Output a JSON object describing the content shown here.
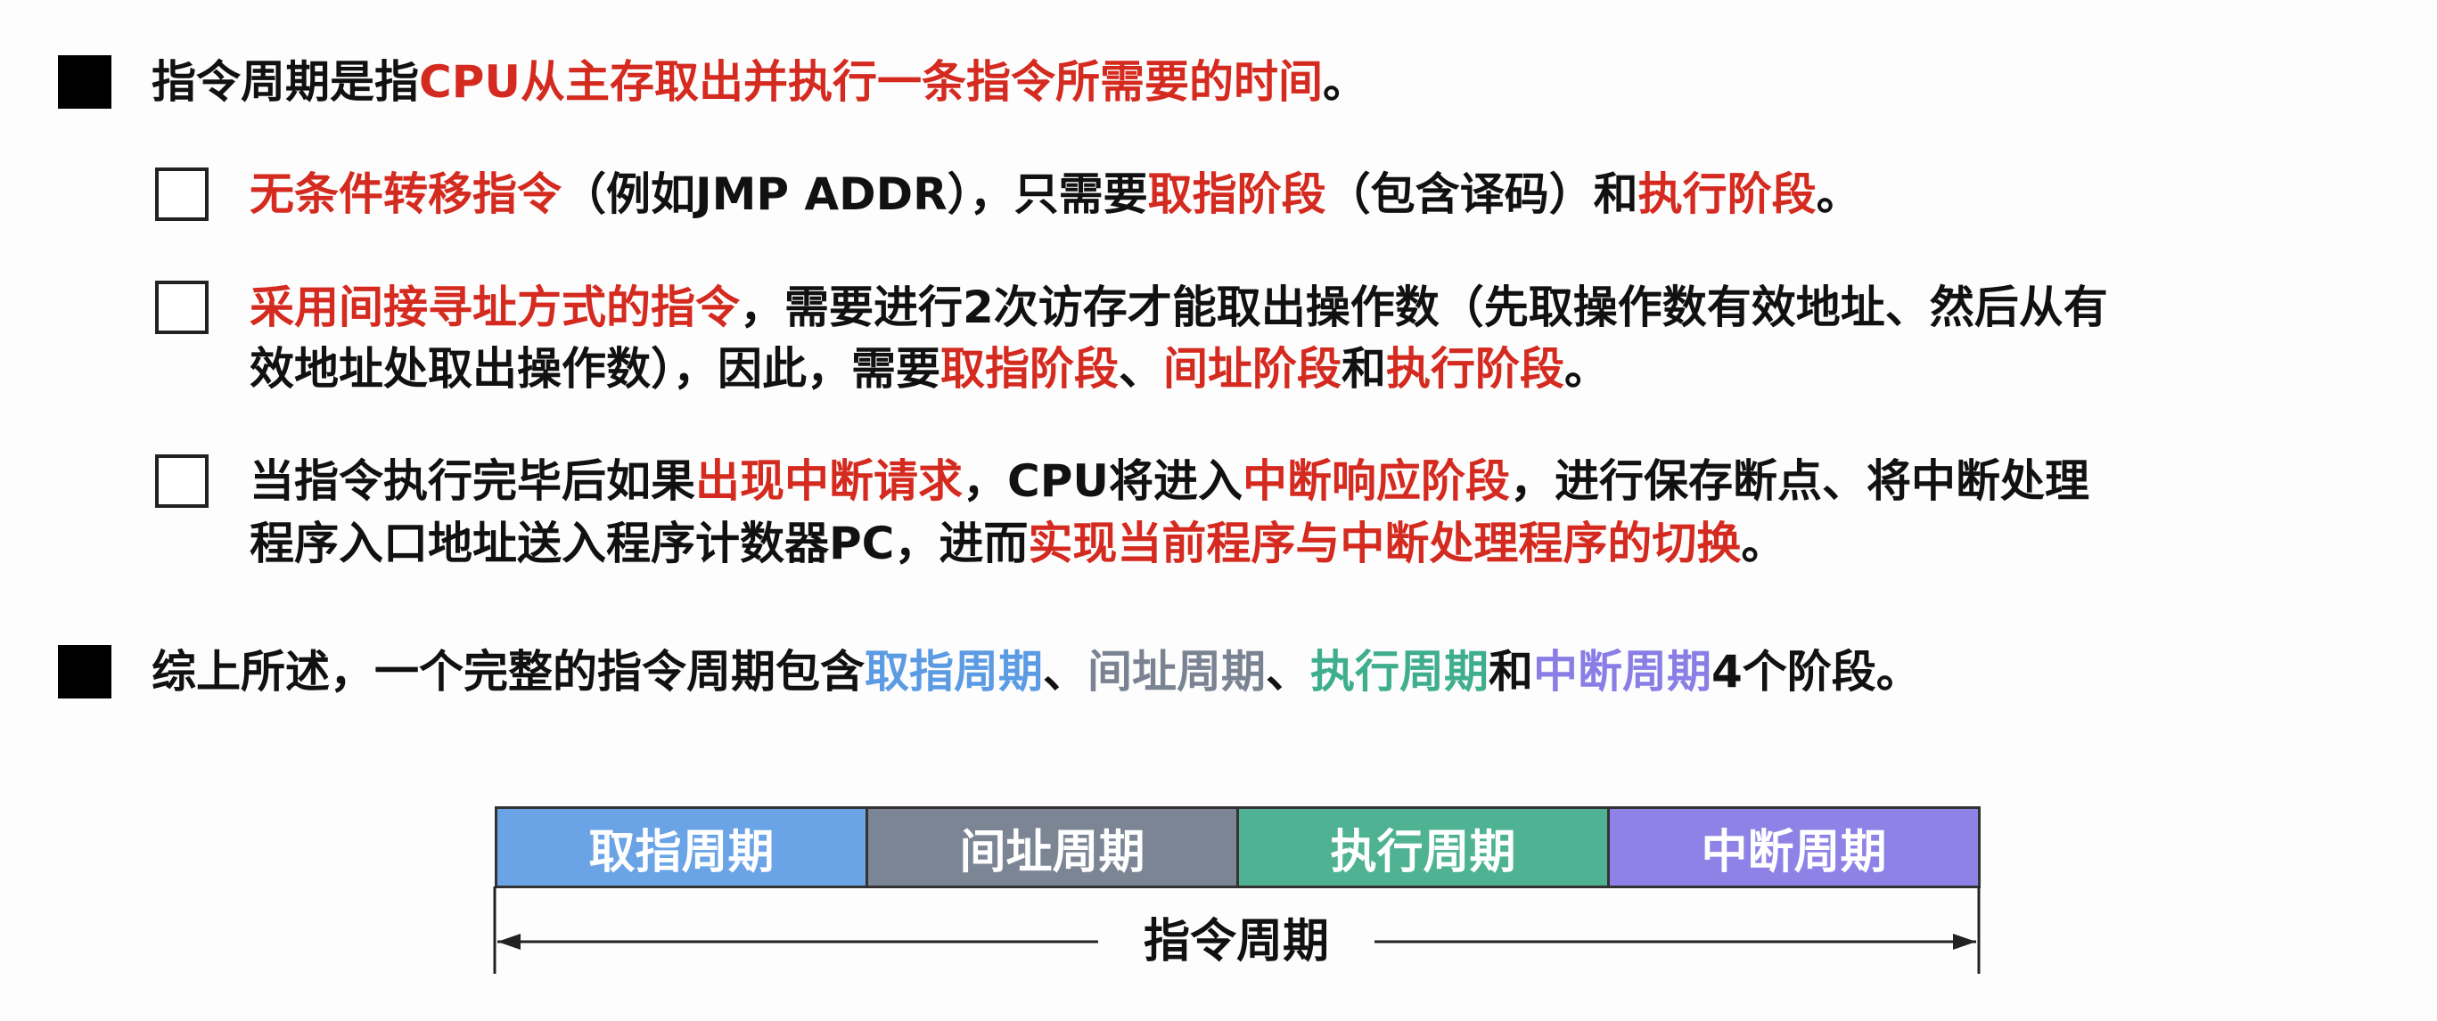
{
  "bullet1": {
    "prefix": "指令周期是指",
    "highlight": "CPU从主存取出并执行一条指令所需要的时间",
    "suffix": "。"
  },
  "sub1": {
    "h1": "无条件转移指令",
    "t1": "（例如JMP ADDR），只需要",
    "h2": "取指阶段",
    "t2": "（包含译码）和",
    "h3": "执行阶段",
    "t3": "。"
  },
  "sub2": {
    "h1": "采用间接寻址方式的指令",
    "t1": "，需要进行2次访存才能取出操作数（先取操作数有效地址、然后从有",
    "t2": "效地址处取出操作数），因此，需要",
    "h2": "取指阶段",
    "t3": "、",
    "h3": "间址阶段",
    "t4": "和",
    "h4": "执行阶段",
    "t5": "。"
  },
  "sub3": {
    "t1": "当指令执行完毕后如果",
    "h1": "出现中断请求",
    "t2": "，CPU将进入",
    "h2": "中断响应阶段",
    "t3": "，进行保存断点、将中断处理",
    "t4": "程序入口地址送入程序计数器PC，进而",
    "h3": "实现当前程序与中断处理程序的切换",
    "t5": "。"
  },
  "bullet2": {
    "prefix": "综上所述，一个完整的指令周期包含",
    "p1": "取指周期",
    "sep1": "、",
    "p2": "间址周期",
    "sep2": "、",
    "p3": "执行周期",
    "sep3": "和",
    "p4": "中断周期",
    "suffix": "4个阶段。"
  },
  "diagram": {
    "segments": [
      {
        "label": "取指周期",
        "color": "#6aa3e6"
      },
      {
        "label": "间址周期",
        "color": "#7b8594"
      },
      {
        "label": "执行周期",
        "color": "#4fb393"
      },
      {
        "label": "中断周期",
        "color": "#8f82e6"
      }
    ],
    "span_label": "指令周期"
  }
}
